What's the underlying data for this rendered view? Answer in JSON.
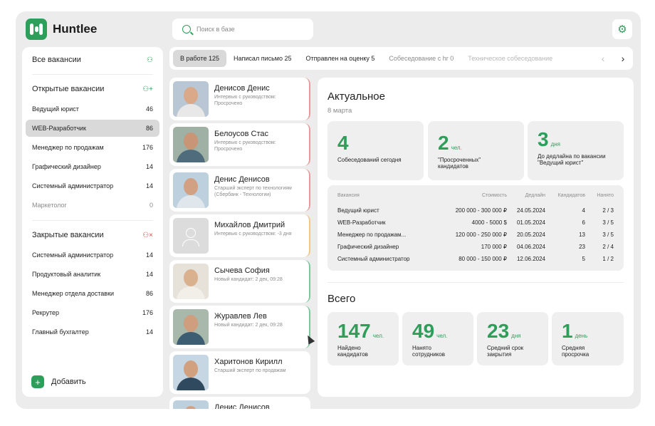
{
  "app": {
    "name": "Huntlee"
  },
  "search": {
    "placeholder": "Поиск в базе"
  },
  "sidebar": {
    "all_label": "Все вакансии",
    "open_header": "Открытые вакансии",
    "open_items": [
      {
        "label": "Ведущий юрист",
        "count": "46"
      },
      {
        "label": "WEB-Разработчик",
        "count": "86"
      },
      {
        "label": "Менеджер по продажам",
        "count": "176"
      },
      {
        "label": "Графический дизайнер",
        "count": "14"
      },
      {
        "label": "Системный администратор",
        "count": "14"
      },
      {
        "label": "Маркетолог",
        "count": "0"
      }
    ],
    "closed_header": "Закрытые вакансии",
    "closed_items": [
      {
        "label": "Системный администратор",
        "count": "14"
      },
      {
        "label": "Продуктовый аналитик",
        "count": "14"
      },
      {
        "label": "Менеджер отдела доставки",
        "count": "86"
      },
      {
        "label": "Рекрутер",
        "count": "176"
      },
      {
        "label": "Главный бухгалтер",
        "count": "14"
      }
    ],
    "add_label": "Добавить"
  },
  "tabs": [
    {
      "label": "В работе 125"
    },
    {
      "label": "Написал письмо 25"
    },
    {
      "label": "Отправлен на оценку 5"
    },
    {
      "label": "Собеседование с hr 0"
    },
    {
      "label": "Техническое собеседование"
    }
  ],
  "candidates": [
    {
      "name": "Денисов Денис",
      "status": "Интервью с руководством: Просрочено"
    },
    {
      "name": "Белоусов Стас",
      "status": "Интервью с руководством: Просрочено"
    },
    {
      "name": "Денис Денисов",
      "status": "Старший эксперт по технологиям (Сбербанк - Технологии)"
    },
    {
      "name": "Михайлов Дмитрий",
      "status": "Интервью с руководством: -3 дня"
    },
    {
      "name": "Сычева София",
      "status": "Новый кандидат: 2 дек, 09:28"
    },
    {
      "name": "Журавлев Лев",
      "status": "Новый кандидат: 2 дек, 09:28"
    },
    {
      "name": "Харитонов Кирилл",
      "status": "Старший эксперт по продажам"
    },
    {
      "name": "Денис Денисов",
      "status": ""
    }
  ],
  "actual": {
    "title": "Актуальное",
    "date": "8 марта",
    "stats": [
      {
        "value": "4",
        "unit": "",
        "label": "Собеседований сегодня"
      },
      {
        "value": "2",
        "unit": "чел.",
        "label": "\"Просроченных\" кандидатов"
      },
      {
        "value": "3",
        "unit": "дня",
        "label": "До дедлайна по вакансии \"Ведущий юрист\""
      }
    ]
  },
  "vacancy_table": {
    "headers": [
      "Вакансия",
      "Стоимость",
      "Дедлайн",
      "Кандидатов",
      "Нанято"
    ],
    "rows": [
      [
        "Ведущий юрист",
        "200 000 - 300 000 ₽",
        "24.05.2024",
        "4",
        "2 / 3"
      ],
      [
        "WEB-Разработчик",
        "4000 - 5000 $",
        "01.05.2024",
        "6",
        "3 / 5"
      ],
      [
        "Менеджер по продажам...",
        "120 000 - 250 000 ₽",
        "20.05.2024",
        "13",
        "3 / 5"
      ],
      [
        "Графический дизайнер",
        "170 000 ₽",
        "04.06.2024",
        "23",
        "2 / 4"
      ],
      [
        "Системный администратор",
        "80 000 - 150 000 ₽",
        "12.06.2024",
        "5",
        "1 / 2"
      ]
    ]
  },
  "total": {
    "title": "Всего",
    "stats": [
      {
        "value": "147",
        "unit": "чел.",
        "label": "Найдено кандидатов"
      },
      {
        "value": "49",
        "unit": "чел.",
        "label": "Нанято сотрудников"
      },
      {
        "value": "23",
        "unit": "дня",
        "label": "Средний срок закрытия"
      },
      {
        "value": "1",
        "unit": "день",
        "label": "Средняя просрочка"
      }
    ]
  },
  "colors": {
    "accent": "#2e9e5b",
    "overdue": "#e99b9b",
    "warning": "#f2c782",
    "new": "#7cc89a"
  }
}
